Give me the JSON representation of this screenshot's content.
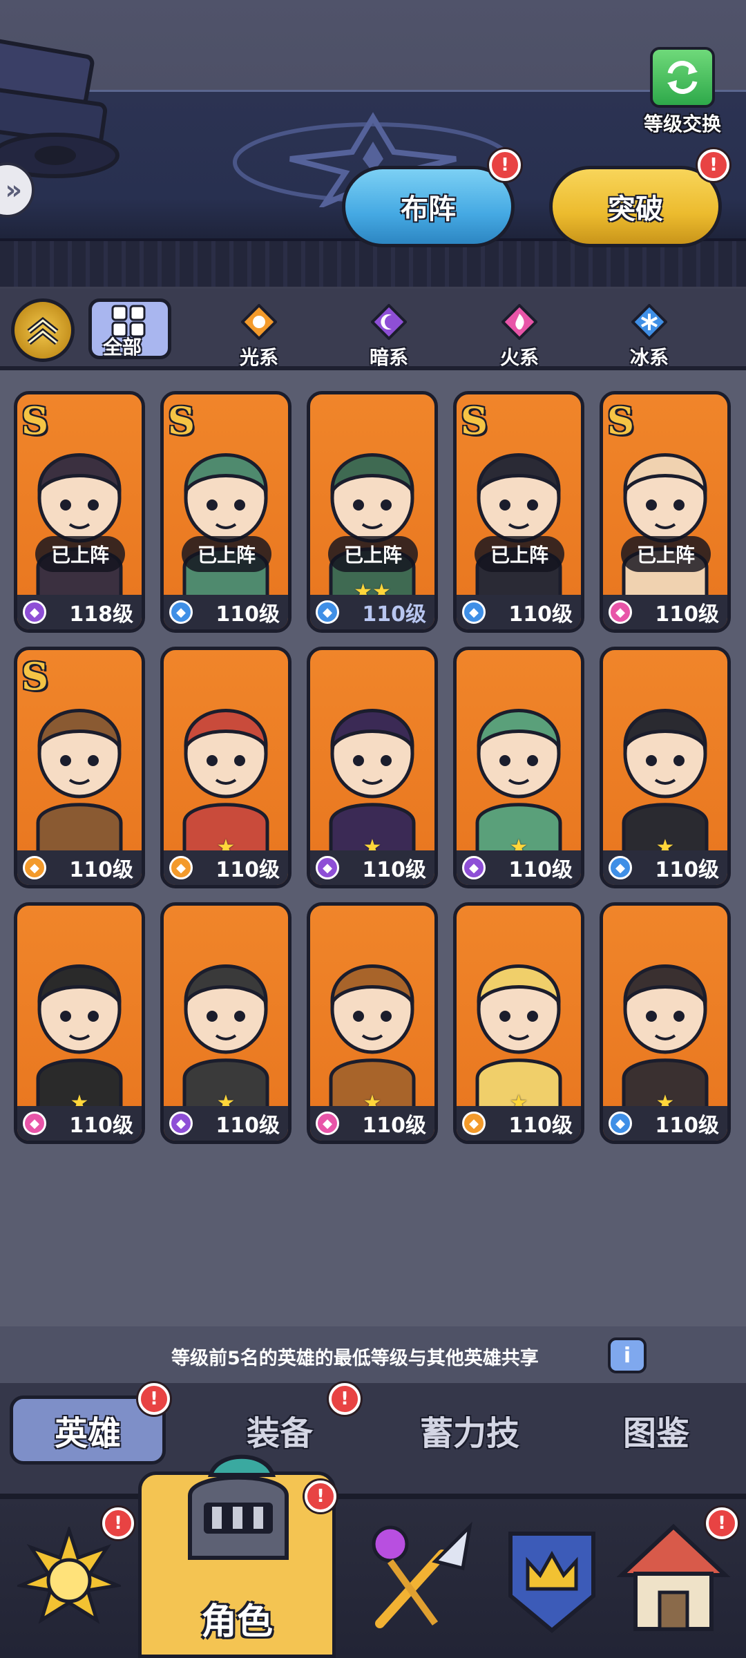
{
  "header": {
    "level_swap_label": "等级交换",
    "formation_label": "布阵",
    "breakthrough_label": "突破",
    "alert_mark": "!"
  },
  "filters": [
    {
      "label": "全部",
      "icon": "grid-icon"
    },
    {
      "label": "光系",
      "icon": "light-element-icon",
      "color": "#f39a2b"
    },
    {
      "label": "暗系",
      "icon": "dark-element-icon",
      "color": "#8e4fd6"
    },
    {
      "label": "火系",
      "icon": "fire-element-icon",
      "color": "#e855a8"
    },
    {
      "label": "冰系",
      "icon": "ice-element-icon",
      "color": "#3f8fe6"
    }
  ],
  "heroes": [
    {
      "rank": "S",
      "status": "已上阵",
      "element": "dark",
      "level": "118级",
      "stars": ""
    },
    {
      "rank": "S",
      "status": "已上阵",
      "element": "ice",
      "level": "110级",
      "stars": ""
    },
    {
      "rank": "",
      "status": "已上阵",
      "element": "ice",
      "level": "110级",
      "stars": "★★"
    },
    {
      "rank": "S",
      "status": "已上阵",
      "element": "ice",
      "level": "110级",
      "stars": ""
    },
    {
      "rank": "S",
      "status": "已上阵",
      "element": "fire",
      "level": "110级",
      "stars": ""
    },
    {
      "rank": "S",
      "status": "",
      "element": "light",
      "level": "110级",
      "stars": ""
    },
    {
      "rank": "",
      "status": "",
      "element": "light",
      "level": "110级",
      "stars": "★"
    },
    {
      "rank": "",
      "status": "",
      "element": "dark",
      "level": "110级",
      "stars": "★"
    },
    {
      "rank": "",
      "status": "",
      "element": "dark",
      "level": "110级",
      "stars": "★"
    },
    {
      "rank": "",
      "status": "",
      "element": "ice",
      "level": "110级",
      "stars": "★"
    },
    {
      "rank": "",
      "status": "",
      "element": "fire",
      "level": "110级",
      "stars": "★"
    },
    {
      "rank": "",
      "status": "",
      "element": "dark",
      "level": "110级",
      "stars": "★"
    },
    {
      "rank": "",
      "status": "",
      "element": "fire",
      "level": "110级",
      "stars": "★"
    },
    {
      "rank": "",
      "status": "",
      "element": "light",
      "level": "110级",
      "stars": "★"
    },
    {
      "rank": "",
      "status": "",
      "element": "ice",
      "level": "110级",
      "stars": "★"
    }
  ],
  "element_colors": {
    "light": "#f39a2b",
    "dark": "#8e4fd6",
    "fire": "#e855a8",
    "ice": "#3f8fe6"
  },
  "info": {
    "text": "等级前5名的英雄的最低等级与其他英雄共享",
    "button": "i"
  },
  "subtabs": [
    "英雄",
    "装备",
    "蓄力技",
    "图鉴"
  ],
  "bottom_nav": {
    "active_label": "角色",
    "items": [
      "sun-icon",
      "knight-helmet-icon",
      "magic-sword-icon",
      "crown-shield-icon",
      "house-icon"
    ]
  }
}
